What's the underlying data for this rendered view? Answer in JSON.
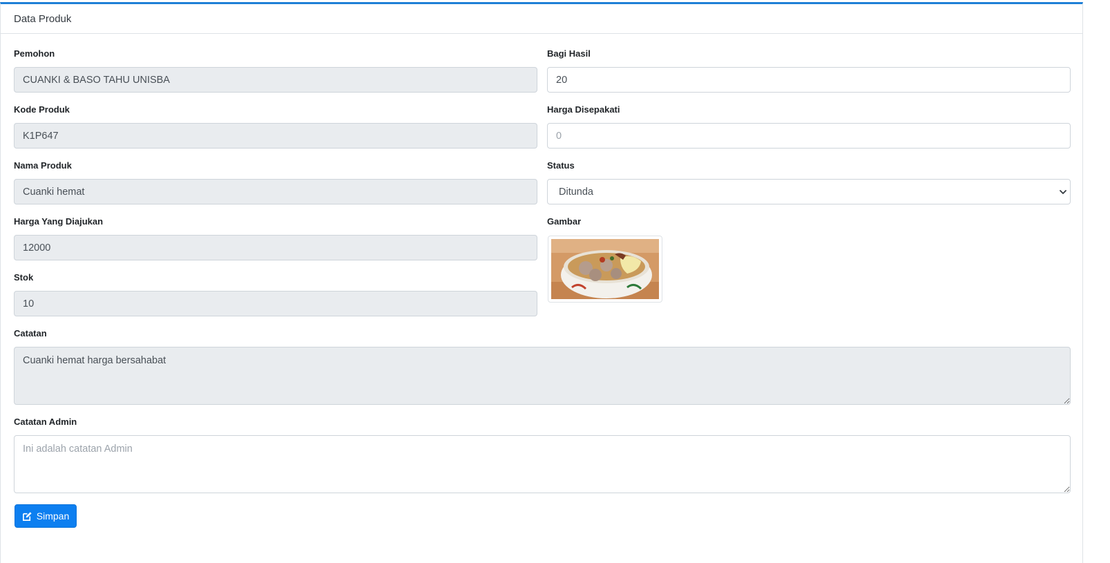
{
  "header": {
    "title": "Data Produk"
  },
  "form": {
    "pemohon": {
      "label": "Pemohon",
      "value": "CUANKI & BASO TAHU UNISBA"
    },
    "kode_produk": {
      "label": "Kode Produk",
      "value": "K1P647"
    },
    "nama_produk": {
      "label": "Nama Produk",
      "value": "Cuanki hemat"
    },
    "harga_diajukan": {
      "label": "Harga Yang Diajukan",
      "value": "12000"
    },
    "stok": {
      "label": "Stok",
      "value": "10"
    },
    "bagi_hasil": {
      "label": "Bagi Hasil",
      "value": "20"
    },
    "harga_disepakati": {
      "label": "Harga Disepakati",
      "value": "",
      "placeholder": "0"
    },
    "status": {
      "label": "Status",
      "selected": "Ditunda"
    },
    "gambar": {
      "label": "Gambar",
      "image": "food-bowl-photo"
    },
    "catatan": {
      "label": "Catatan",
      "value": "Cuanki hemat harga bersahabat"
    },
    "catatan_admin": {
      "label": "Catatan Admin",
      "value": "",
      "placeholder": "Ini adalah catatan Admin"
    }
  },
  "actions": {
    "save_label": "Simpan",
    "save_icon": "edit-icon"
  },
  "colors": {
    "accent": "#1e7fd6",
    "button": "#0d7ff0",
    "readonly_bg": "#e9ecef"
  }
}
